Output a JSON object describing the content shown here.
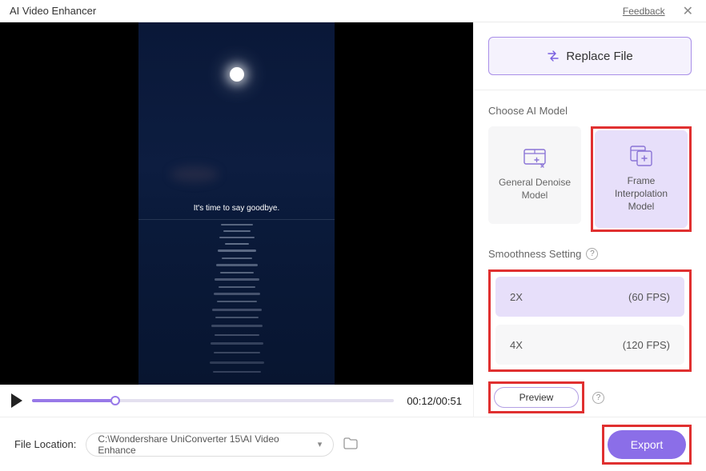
{
  "titlebar": {
    "title": "AI Video Enhancer",
    "feedback": "Feedback"
  },
  "video": {
    "subtitle": "It's time to say goodbye.",
    "time": "00:12/00:51"
  },
  "replace": {
    "label": "Replace File"
  },
  "models": {
    "section": "Choose AI Model",
    "denoise": "General Denoise Model",
    "interp": "Frame Interpolation Model"
  },
  "smoothness": {
    "section": "Smoothness Setting",
    "opt1": {
      "mult": "2X",
      "fps": "(60 FPS)"
    },
    "opt2": {
      "mult": "4X",
      "fps": "(120 FPS)"
    }
  },
  "preview": {
    "label": "Preview"
  },
  "location": {
    "label": "File Location:",
    "path": "C:\\Wondershare UniConverter 15\\AI Video Enhance"
  },
  "export": {
    "label": "Export"
  }
}
